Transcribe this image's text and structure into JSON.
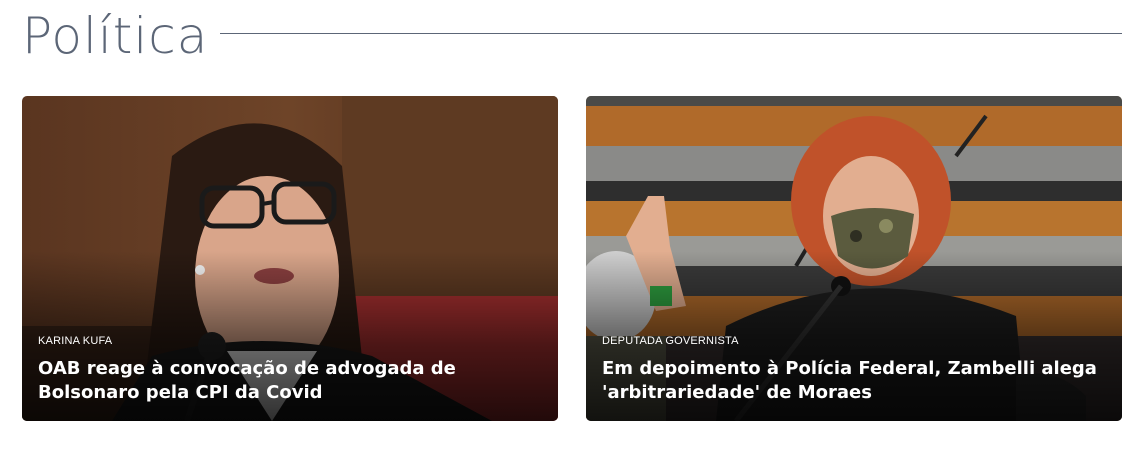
{
  "section": {
    "title": "Política"
  },
  "cards": [
    {
      "kicker": "KARINA KUFA",
      "headline": "OAB reage à convocação de advogada de Bolsonaro pela CPI da Covid"
    },
    {
      "kicker": "DEPUTADA GOVERNISTA",
      "headline": "Em depoimento à Polícia Federal, Zambelli alega 'arbitrariedade' de Moraes"
    }
  ],
  "colors": {
    "title": "#5c6677",
    "rule": "#5c6677",
    "overlay_text": "#ffffff"
  }
}
